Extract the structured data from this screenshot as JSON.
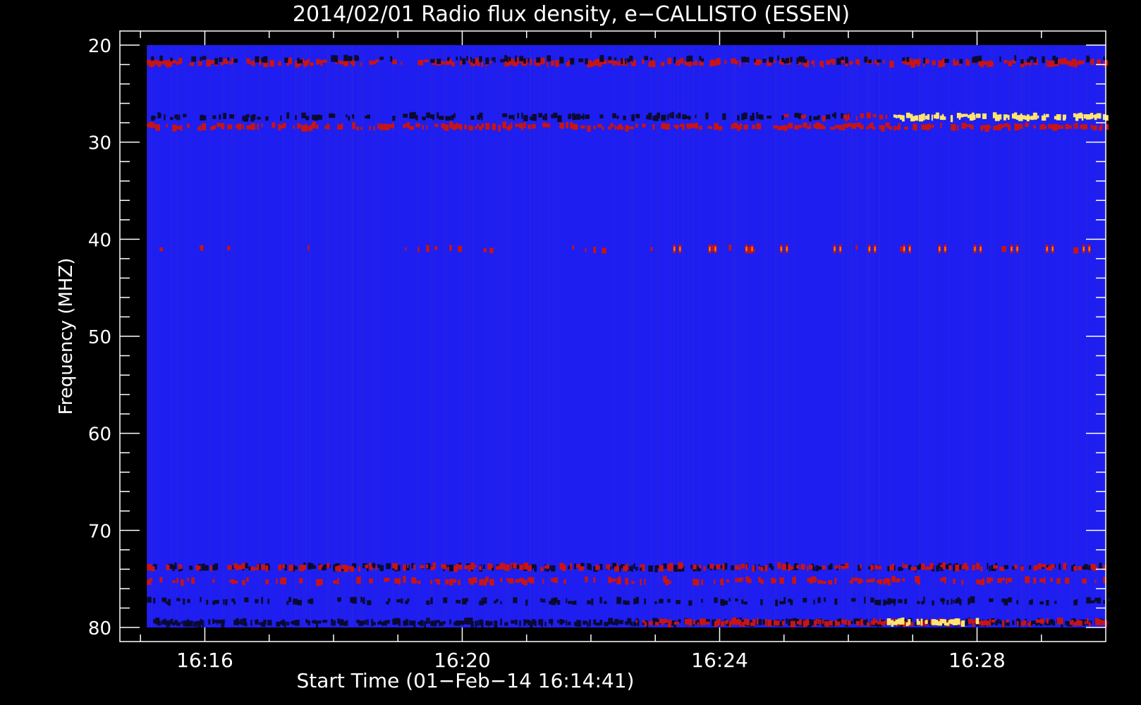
{
  "chart_data": {
    "type": "heatmap",
    "title": "2014/02/01  Radio flux density, e−CALLISTO (ESSEN)",
    "xlabel": "Start Time (01−Feb−14 16:14:41)",
    "ylabel": "Frequency (MHZ)",
    "x_unit": "minutes after 16:00 UT",
    "xlim": [
      14.68,
      30.0
    ],
    "ylim": [
      20,
      80
    ],
    "y_axis_inverted": true,
    "x_data_range": [
      15.1,
      30.0
    ],
    "x_ticks": [
      {
        "value": 16,
        "label": "16:16"
      },
      {
        "value": 20,
        "label": "16:20"
      },
      {
        "value": 24,
        "label": "16:24"
      },
      {
        "value": 28,
        "label": "16:28"
      }
    ],
    "y_ticks": [
      {
        "value": 20,
        "label": "20"
      },
      {
        "value": 30,
        "label": "30"
      },
      {
        "value": 40,
        "label": "40"
      },
      {
        "value": 50,
        "label": "50"
      },
      {
        "value": 60,
        "label": "60"
      },
      {
        "value": 70,
        "label": "70"
      },
      {
        "value": 80,
        "label": "80"
      }
    ],
    "background_color": "#1e1ef0",
    "colors": {
      "black": "#0a0a30",
      "red": "#c81414",
      "orange": "#ff8c00",
      "yellow": "#ffe66e",
      "white": "#ffffff"
    },
    "bands": [
      {
        "freq": 21.8,
        "x0": 15.1,
        "x1": 30.0,
        "color": "red",
        "density": 0.55
      },
      {
        "freq": 21.5,
        "x0": 15.1,
        "x1": 30.0,
        "color": "black",
        "density": 0.25
      },
      {
        "freq": 27.4,
        "x0": 15.1,
        "x1": 26.0,
        "color": "black",
        "density": 0.35
      },
      {
        "freq": 28.4,
        "x0": 15.1,
        "x1": 30.0,
        "color": "red",
        "density": 0.55
      },
      {
        "freq": 27.4,
        "x0": 26.7,
        "x1": 30.0,
        "color": "yellow",
        "density": 0.75
      },
      {
        "freq": 27.4,
        "x0": 25.0,
        "x1": 26.7,
        "color": "red",
        "density": 0.35
      },
      {
        "freq": 41.0,
        "x0": 15.1,
        "x1": 30.0,
        "color": "red",
        "density": 0.08
      },
      {
        "freq": 73.8,
        "x0": 15.1,
        "x1": 30.0,
        "color": "black",
        "density": 0.4
      },
      {
        "freq": 73.8,
        "x0": 15.1,
        "x1": 30.0,
        "color": "red",
        "density": 0.35
      },
      {
        "freq": 75.2,
        "x0": 15.1,
        "x1": 30.0,
        "color": "red",
        "density": 0.3
      },
      {
        "freq": 77.3,
        "x0": 15.1,
        "x1": 30.0,
        "color": "black",
        "density": 0.35
      },
      {
        "freq": 79.5,
        "x0": 15.1,
        "x1": 30.0,
        "color": "black",
        "density": 0.7
      },
      {
        "freq": 79.5,
        "x0": 22.7,
        "x1": 30.0,
        "color": "red",
        "density": 0.55
      },
      {
        "freq": 79.5,
        "x0": 26.6,
        "x1": 28.0,
        "color": "yellow",
        "density": 0.7
      }
    ],
    "bursts_41mhz": [
      23.33,
      23.88,
      24.45,
      24.99,
      25.82,
      26.36,
      26.9,
      27.45,
      28.0,
      28.57,
      29.12,
      29.69
    ]
  }
}
